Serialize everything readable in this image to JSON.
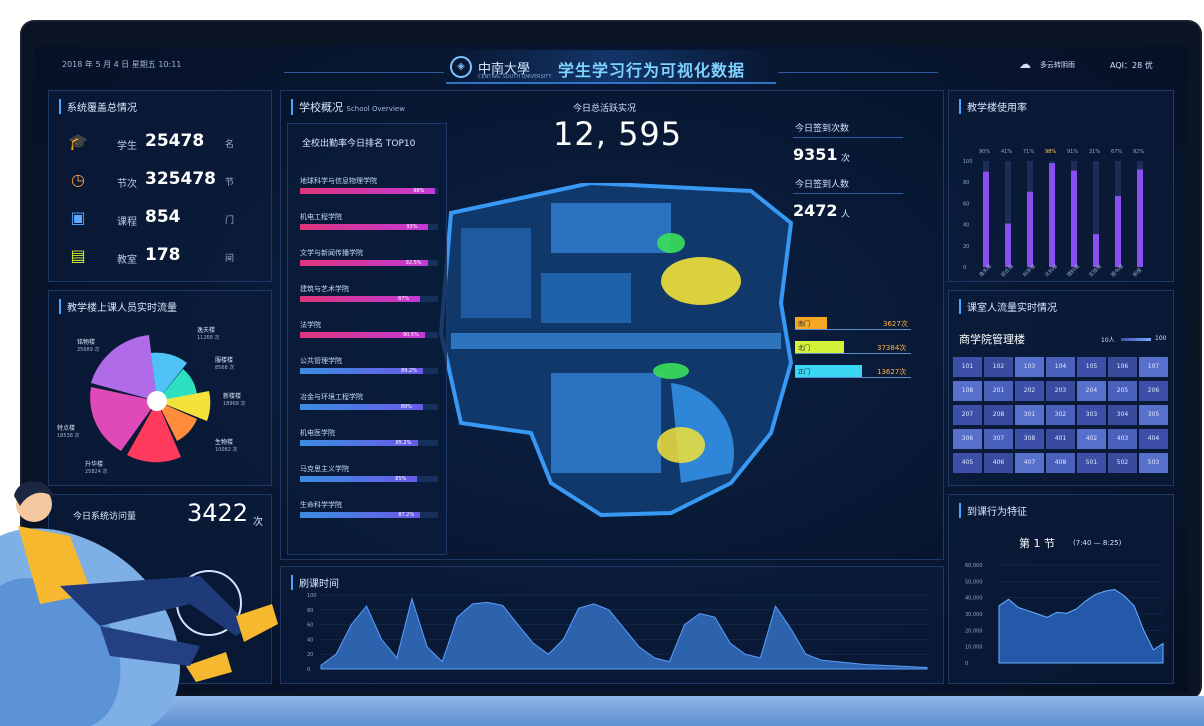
{
  "header": {
    "datetime": "2018 年 5 月 4 日  星期五   10:11",
    "university_cn": "中南大學",
    "university_en": "CENTRAL SOUTH UNIVERSITY",
    "title": "学生学习行为可视化数据",
    "weather": "多云转阴雨",
    "aqi": "AQI：28 优"
  },
  "overview": {
    "title": "系统覆盖总情况",
    "items": [
      {
        "icon": "graduation-cap-icon",
        "label": "学生",
        "value": "25478",
        "unit": "名"
      },
      {
        "icon": "clock-icon",
        "label": "节次",
        "value": "325478",
        "unit": "节"
      },
      {
        "icon": "book-icon",
        "label": "课程",
        "value": "854",
        "unit": "门"
      },
      {
        "icon": "classroom-icon",
        "label": "教室",
        "value": "178",
        "unit": "间"
      }
    ]
  },
  "building_flow": {
    "title": "教学楼上课人员实时流量",
    "labels": [
      {
        "name": "铭物楼",
        "count": "25689 次"
      },
      {
        "name": "逸夫楼",
        "count": "11268 次"
      },
      {
        "name": "服楼楼",
        "count": "8568 次"
      },
      {
        "name": "新楼楼",
        "count": "18968 次"
      },
      {
        "name": "生物楼",
        "count": "10082 次"
      },
      {
        "name": "升华楼",
        "count": "25824 次"
      },
      {
        "name": "特点楼",
        "count": "18538 次"
      }
    ]
  },
  "visits": {
    "title": "今日系统访问量",
    "value": "3422",
    "unit": "次"
  },
  "school": {
    "title": "学校概况",
    "subtitle": "School Overview",
    "top10_title": "全校出勤率今日排名  TOP10",
    "top10": [
      {
        "name": "地球科学与信息物理学院",
        "pct": 98,
        "display": "98%"
      },
      {
        "name": "机电工程学院",
        "pct": 93,
        "display": "93%"
      },
      {
        "name": "文学与新闻传播学院",
        "pct": 92.5,
        "display": "92.5%"
      },
      {
        "name": "建筑与艺术学院",
        "pct": 87,
        "display": "87%"
      },
      {
        "name": "法学院",
        "pct": 90.5,
        "display": "90.5%"
      },
      {
        "name": "公共管理学院",
        "pct": 89.2,
        "display": "89.2%"
      },
      {
        "name": "冶金与环境工程学院",
        "pct": 89,
        "display": "89%"
      },
      {
        "name": "机电医学院",
        "pct": 85.2,
        "display": "85.2%"
      },
      {
        "name": "马克思主义学院",
        "pct": 85,
        "display": "85%"
      },
      {
        "name": "生命科学学院",
        "pct": 87.2,
        "display": "87.2%"
      }
    ]
  },
  "center": {
    "active_label": "今日总活跃实况",
    "active_value": "12, 595",
    "checkin_times_label": "今日签到次数",
    "checkin_times_value": "9351",
    "checkin_times_unit": "次",
    "checkin_people_label": "今日签到人数",
    "checkin_people_value": "2472",
    "checkin_people_unit": "人"
  },
  "gates": [
    {
      "name": "南门",
      "value": "3627次",
      "color": "#f5a623",
      "frac": 0.28
    },
    {
      "name": "北门",
      "value": "37384次",
      "color": "#d4f23a",
      "frac": 0.42
    },
    {
      "name": "正门",
      "value": "13627次",
      "color": "#3ad7f2",
      "frac": 0.58
    }
  ],
  "usage": {
    "title": "教学楼使用率",
    "percents": [
      "90%",
      "41%",
      "71%",
      "98%",
      "91%",
      "31%",
      "67%",
      "92%"
    ],
    "values": [
      90,
      41,
      71,
      98,
      91,
      31,
      67,
      92
    ],
    "buildings": [
      "逸夫楼",
      "综合楼",
      "科学楼",
      "文科楼",
      "理科楼",
      "实验楼",
      "图书楼",
      "新楼"
    ],
    "ymax": 100,
    "yticks": [
      "100",
      "80",
      "60",
      "40",
      "20",
      "0"
    ]
  },
  "classroom": {
    "title": "课室人流量实时情况",
    "building": "商学院管理楼",
    "legend_min": "10人",
    "legend_max": "100",
    "rooms": [
      "101",
      "102",
      "103",
      "104",
      "105",
      "106",
      "107",
      "108",
      "201",
      "202",
      "203",
      "204",
      "205",
      "206",
      "207",
      "208",
      "301",
      "302",
      "303",
      "304",
      "305",
      "306",
      "307",
      "308",
      "401",
      "402",
      "403",
      "404",
      "405",
      "406",
      "407",
      "408",
      "501",
      "502",
      "503"
    ]
  },
  "attendance": {
    "title": "到课行为特征",
    "period": "第 1 节",
    "period_time": "(7:40 — 8:25)",
    "yticks": [
      "60,000",
      "50,000",
      "40,000",
      "30,000",
      "20,000",
      "10,000",
      "0"
    ]
  },
  "timeline": {
    "title": "刷课时间"
  },
  "chart_data": [
    {
      "type": "bar",
      "title": "教学楼使用率",
      "categories": [
        "逸夫楼",
        "综合楼",
        "科学楼",
        "文科楼",
        "理科楼",
        "实验楼",
        "图书楼",
        "新楼"
      ],
      "values": [
        90,
        41,
        71,
        98,
        91,
        31,
        67,
        92
      ],
      "ylim": [
        0,
        100
      ]
    },
    {
      "type": "area",
      "title": "刷课时间",
      "x": [
        0,
        1,
        2,
        3,
        4,
        5,
        6,
        7,
        8,
        9,
        10,
        11,
        12,
        13,
        14,
        15,
        16,
        17,
        18,
        19,
        20,
        21,
        22,
        23,
        24,
        25,
        26,
        27,
        28,
        29,
        30,
        31,
        32,
        33,
        34,
        35,
        36,
        37,
        38,
        39,
        40
      ],
      "values": [
        5,
        20,
        60,
        85,
        40,
        15,
        95,
        30,
        10,
        70,
        88,
        90,
        86,
        60,
        35,
        20,
        40,
        82,
        88,
        80,
        55,
        30,
        15,
        10,
        60,
        75,
        70,
        35,
        20,
        15,
        85,
        55,
        20,
        12,
        10,
        8,
        6,
        5,
        4,
        3,
        2
      ],
      "ylim": [
        0,
        100
      ]
    },
    {
      "type": "area",
      "title": "到课行为特征",
      "x": [
        0,
        1,
        2,
        3,
        4,
        5,
        6,
        7,
        8,
        9,
        10,
        11,
        12,
        13,
        14,
        15,
        16,
        17
      ],
      "values": [
        35000,
        39000,
        34000,
        32000,
        30000,
        28000,
        31000,
        30500,
        33000,
        38000,
        42000,
        44000,
        45000,
        41000,
        35000,
        20000,
        8000,
        12000
      ],
      "ylim": [
        0,
        60000
      ]
    }
  ]
}
